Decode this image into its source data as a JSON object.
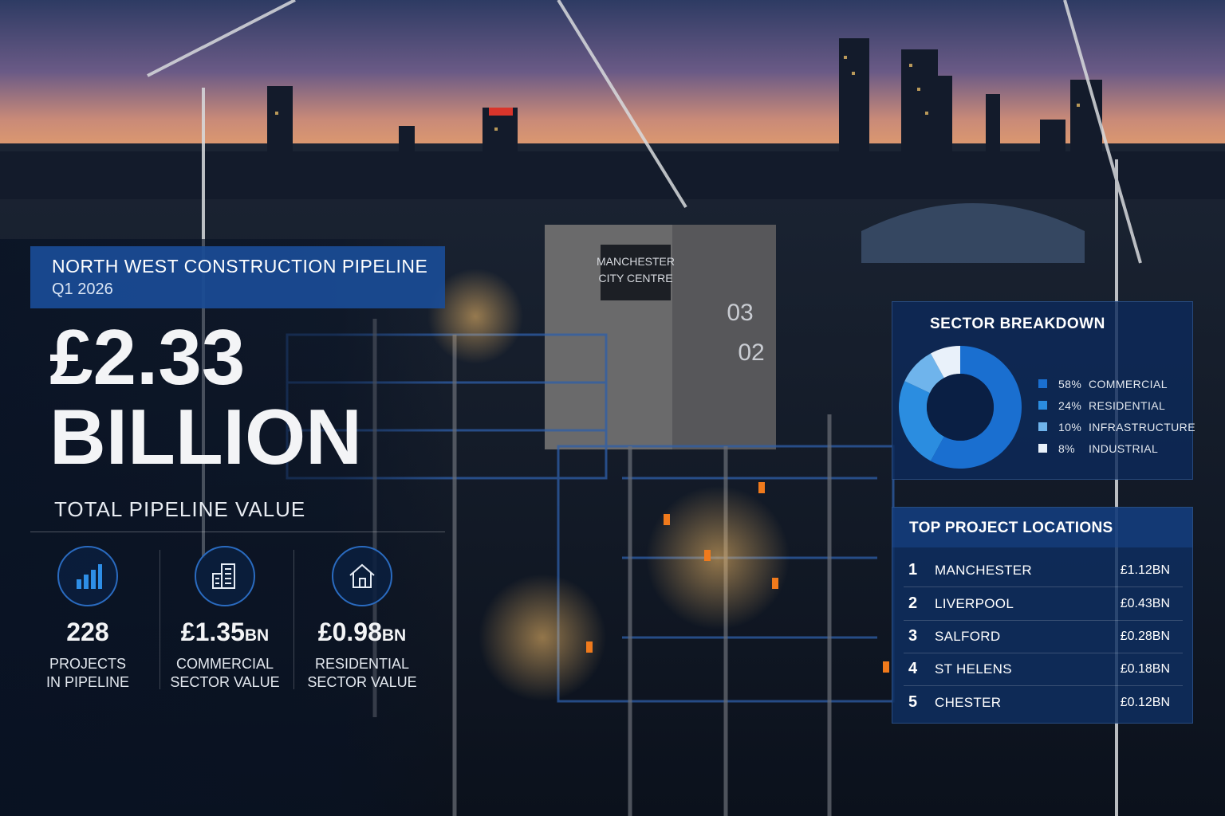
{
  "header": {
    "title": "NORTH WEST CONSTRUCTION PIPELINE",
    "subtitle": "Q1 2026"
  },
  "headline": {
    "value_line1": "£2.33",
    "value_line2": "BILLION",
    "label": "TOTAL PIPELINE VALUE"
  },
  "stats": [
    {
      "icon": "bar-chart-icon",
      "value": "228",
      "unit": "",
      "label_line1": "PROJECTS",
      "label_line2": "IN PIPELINE"
    },
    {
      "icon": "building-icon",
      "value": "£1.35",
      "unit": "BN",
      "label_line1": "COMMERCIAL",
      "label_line2": "SECTOR VALUE"
    },
    {
      "icon": "house-icon",
      "value": "£0.98",
      "unit": "BN",
      "label_line1": "RESIDENTIAL",
      "label_line2": "SECTOR VALUE"
    }
  ],
  "scene_signs": {
    "building_sign_line1": "MANCHESTER",
    "building_sign_line2": "CITY CENTRE",
    "floor_upper": "03",
    "floor_lower": "02"
  },
  "chart_data": [
    {
      "type": "pie",
      "title": "SECTOR BREAKDOWN",
      "categories": [
        "COMMERCIAL",
        "RESIDENTIAL",
        "INFRASTRUCTURE",
        "INDUSTRIAL"
      ],
      "values": [
        58,
        24,
        10,
        8
      ],
      "value_labels": [
        "58%",
        "24%",
        "10%",
        "8%"
      ],
      "colors": [
        "#1a6fd0",
        "#2b8de0",
        "#6fb4ec",
        "#e9f1fa"
      ],
      "donut": true,
      "legend_position": "right"
    },
    {
      "type": "table",
      "title": "TOP PROJECT LOCATIONS",
      "rows": [
        {
          "rank": "1",
          "location": "MANCHESTER",
          "value": "£1.12BN"
        },
        {
          "rank": "2",
          "location": "LIVERPOOL",
          "value": "£0.43BN"
        },
        {
          "rank": "3",
          "location": "SALFORD",
          "value": "£0.28BN"
        },
        {
          "rank": "4",
          "location": "ST HELENS",
          "value": "£0.18BN"
        },
        {
          "rank": "5",
          "location": "CHESTER",
          "value": "£0.12BN"
        }
      ]
    }
  ],
  "colors": {
    "accent_blue": "#1a4c96",
    "panel_navy": "#0c2a5a"
  }
}
